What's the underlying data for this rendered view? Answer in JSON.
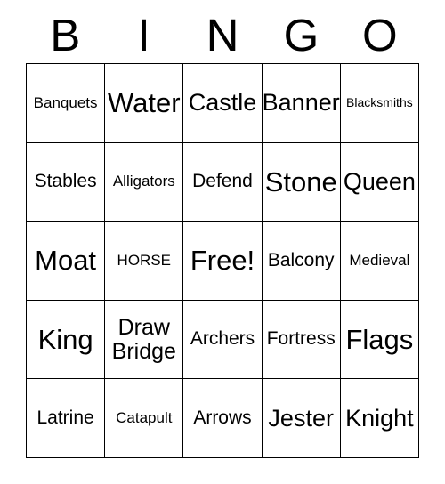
{
  "card": {
    "title": "BINGO",
    "header_letters": [
      "B",
      "I",
      "N",
      "G",
      "O"
    ],
    "rows": [
      [
        {
          "label": "Banquets",
          "size": "sm"
        },
        {
          "label": "Water",
          "size": "xl"
        },
        {
          "label": "Castle",
          "size": "lg"
        },
        {
          "label": "Banner",
          "size": "lg"
        },
        {
          "label": "Blacksmiths",
          "size": "xs"
        }
      ],
      [
        {
          "label": "Stables",
          "size": "md"
        },
        {
          "label": "Alligators",
          "size": "sm"
        },
        {
          "label": "Defend",
          "size": "md"
        },
        {
          "label": "Stone",
          "size": "xl"
        },
        {
          "label": "Queen",
          "size": "lg"
        }
      ],
      [
        {
          "label": "Moat",
          "size": "xl"
        },
        {
          "label": "HORSE",
          "size": "sm"
        },
        {
          "label": "Free!",
          "size": "xl"
        },
        {
          "label": "Balcony",
          "size": "md"
        },
        {
          "label": "Medieval",
          "size": "sm"
        }
      ],
      [
        {
          "label": "King",
          "size": "xl"
        },
        {
          "label": "Draw\nBridge",
          "size": "two"
        },
        {
          "label": "Archers",
          "size": "md"
        },
        {
          "label": "Fortress",
          "size": "md"
        },
        {
          "label": "Flags",
          "size": "xl"
        }
      ],
      [
        {
          "label": "Latrine",
          "size": "md"
        },
        {
          "label": "Catapult",
          "size": "sm"
        },
        {
          "label": "Arrows",
          "size": "md"
        },
        {
          "label": "Jester",
          "size": "lg"
        },
        {
          "label": "Knight",
          "size": "lg"
        }
      ]
    ],
    "free_space": {
      "row": 2,
      "col": 2,
      "label": "Free!"
    },
    "colors": {
      "text": "#000000",
      "background": "#ffffff",
      "border": "#000000"
    }
  }
}
